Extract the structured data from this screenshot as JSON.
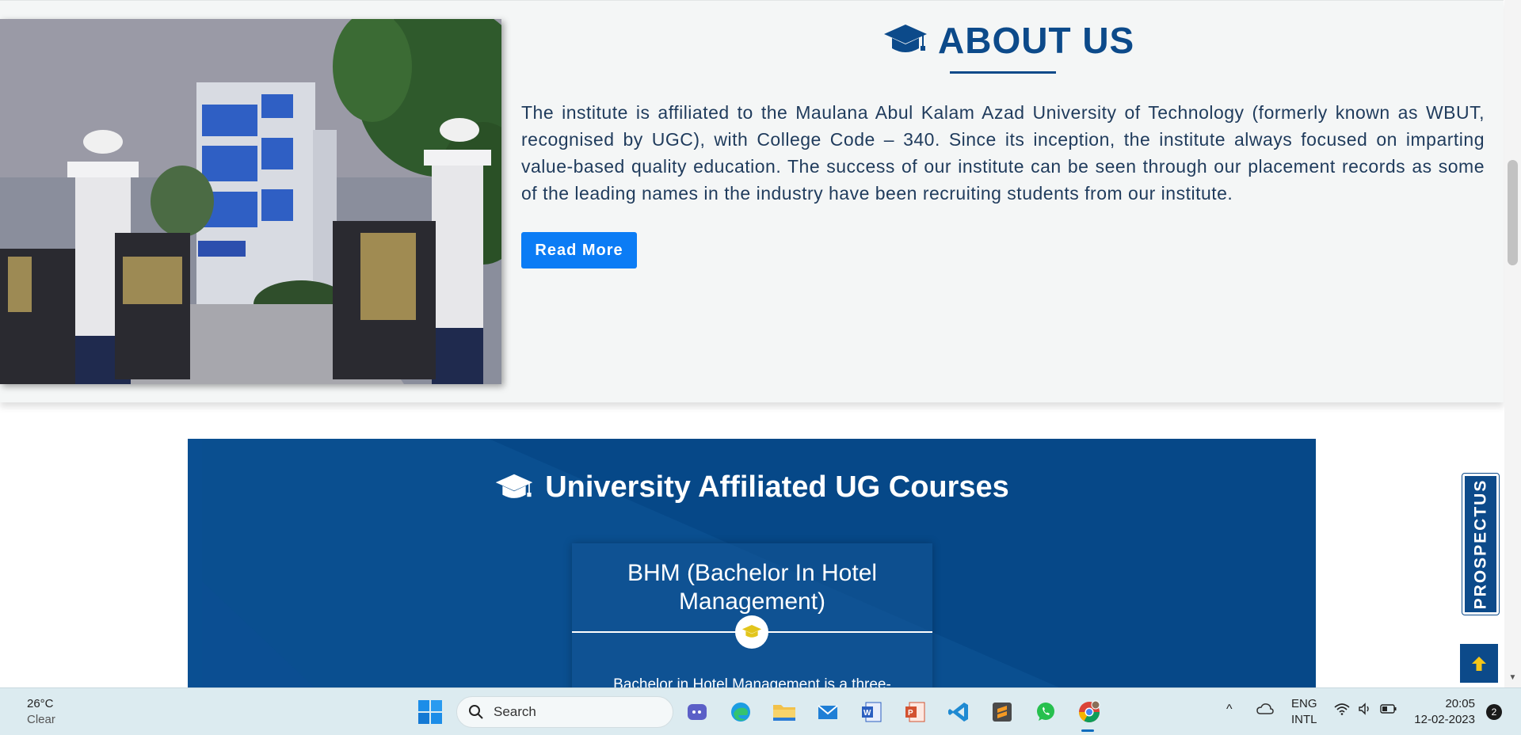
{
  "about": {
    "title": "ABOUT US",
    "text": "The institute is affiliated to the Maulana Abul Kalam Azad University of Technology (formerly known as WBUT, recognised by UGC), with College Code – 340. Since its inception, the institute always focused on imparting value-based quality education. The success of our institute can be seen through our placement records as some of the leading names in the industry have been recruiting students from our institute.",
    "read_more": "Read More"
  },
  "courses": {
    "title": "University Affiliated UG Courses",
    "card": {
      "title": "BHM (Bachelor In Hotel Management)",
      "desc": "Bachelor in Hotel Management is a three-"
    }
  },
  "side": {
    "prospectus": "PROSPECTUS"
  },
  "colors": {
    "brand_blue": "#0c4a8a",
    "button_blue": "#0b7cf5",
    "section_blue": "#064888",
    "badge_gold": "#e2c51c"
  },
  "taskbar": {
    "weather_temp": "26°C",
    "weather_cond": "Clear",
    "search_label": "Search",
    "lang_line1": "ENG",
    "lang_line2": "INTL",
    "time": "20:05",
    "date": "12-02-2023",
    "notification_count": "2",
    "apps": [
      "start-icon",
      "teams-icon",
      "edge-icon",
      "file-explorer-icon",
      "mail-icon",
      "word-icon",
      "powerpoint-icon",
      "vscode-icon",
      "sublime-icon",
      "whatsapp-icon",
      "chrome-icon"
    ]
  }
}
